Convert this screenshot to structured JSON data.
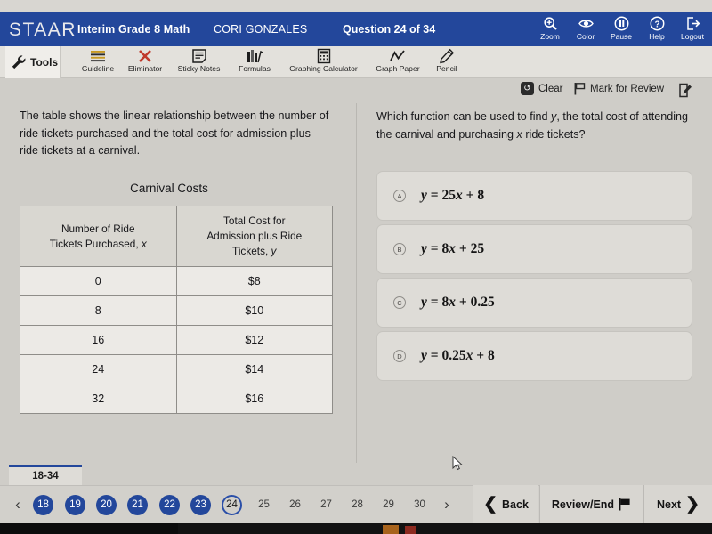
{
  "header": {
    "logo": "STAAR",
    "test_name": "Interim Grade 8 Math",
    "student_name": "CORI GONZALES",
    "question_counter": "Question 24 of 34",
    "accent_color": "#23479b",
    "tools": [
      {
        "label": "Zoom",
        "icon": "magnifier-plus-icon"
      },
      {
        "label": "Color",
        "icon": "eye-icon"
      },
      {
        "label": "Pause",
        "icon": "pause-icon"
      },
      {
        "label": "Help",
        "icon": "question-mark-icon"
      },
      {
        "label": "Logout",
        "icon": "logout-icon"
      }
    ]
  },
  "toolbar": {
    "tools_label": "Tools",
    "wrench_icon": "wrench-icon",
    "items": [
      {
        "label": "Guideline",
        "icon": "guideline-icon"
      },
      {
        "label": "Eliminator",
        "icon": "eliminator-x-icon"
      },
      {
        "label": "Sticky Notes",
        "icon": "sticky-notes-icon"
      },
      {
        "label": "Formulas",
        "icon": "formulas-icon"
      },
      {
        "label": "Graphing Calculator",
        "icon": "calculator-icon"
      },
      {
        "label": "Graph Paper",
        "icon": "graph-paper-icon"
      },
      {
        "label": "Pencil",
        "icon": "pencil-icon"
      }
    ]
  },
  "actions": {
    "clear_label": "Clear",
    "clear_icon": "undo-circle-icon",
    "mark_label": "Mark for Review",
    "mark_icon": "flag-icon",
    "notepad_icon": "notepad-edit-icon"
  },
  "left": {
    "stem": "The table shows the linear relationship between the number of ride tickets purchased and the total cost for admission plus ride tickets at a carnival.",
    "table_title": "Carnival Costs",
    "table": {
      "headers": [
        "Number of Ride Tickets Purchased, x",
        "Total Cost for Admission plus Ride Tickets, y"
      ],
      "header_lines": [
        [
          "Number of Ride",
          "Tickets Purchased, x"
        ],
        [
          "Total Cost for",
          "Admission plus Ride",
          "Tickets, y"
        ]
      ],
      "rows": [
        [
          "0",
          "$8"
        ],
        [
          "8",
          "$10"
        ],
        [
          "16",
          "$12"
        ],
        [
          "24",
          "$14"
        ],
        [
          "32",
          "$16"
        ]
      ]
    }
  },
  "right": {
    "question": "Which function can be used to find y, the total cost of attending the carnival and purchasing x ride tickets?",
    "choices": [
      {
        "letter": "A",
        "text": "y = 25x + 8",
        "selected": false
      },
      {
        "letter": "B",
        "text": "y = 8x + 25",
        "selected": false
      },
      {
        "letter": "C",
        "text": "y = 8x + 0.25",
        "selected": false
      },
      {
        "letter": "D",
        "text": "y = 0.25x + 8",
        "selected": false
      }
    ]
  },
  "footer": {
    "tab_label": "18-34",
    "prev_arrow": "‹",
    "next_arrow": "›",
    "questions": [
      {
        "number": "18",
        "state": "done"
      },
      {
        "number": "19",
        "state": "done"
      },
      {
        "number": "20",
        "state": "done"
      },
      {
        "number": "21",
        "state": "done"
      },
      {
        "number": "22",
        "state": "done"
      },
      {
        "number": "23",
        "state": "done"
      },
      {
        "number": "24",
        "state": "current"
      },
      {
        "number": "25",
        "state": "plain"
      },
      {
        "number": "26",
        "state": "plain"
      },
      {
        "number": "27",
        "state": "plain"
      },
      {
        "number": "28",
        "state": "plain"
      },
      {
        "number": "29",
        "state": "plain"
      },
      {
        "number": "30",
        "state": "plain"
      }
    ],
    "back_label": "Back",
    "review_label": "Review/End",
    "next_label": "Next"
  }
}
